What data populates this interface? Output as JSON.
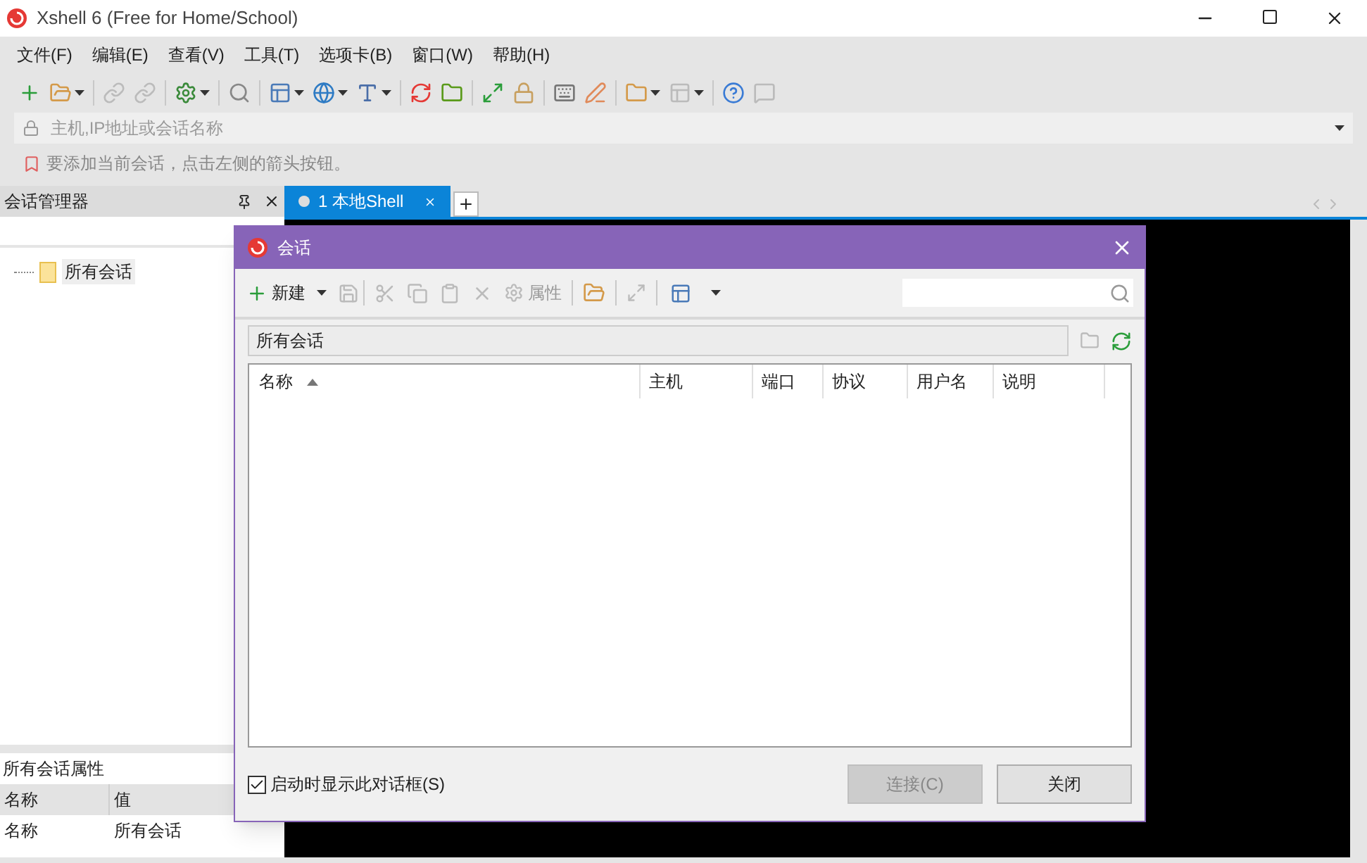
{
  "window": {
    "title": "Xshell 6 (Free for Home/School)"
  },
  "menu": [
    "文件(F)",
    "编辑(E)",
    "查看(V)",
    "工具(T)",
    "选项卡(B)",
    "窗口(W)",
    "帮助(H)"
  ],
  "address_bar": {
    "placeholder": "主机,IP地址或会话名称"
  },
  "hint_bar": {
    "text": "要添加当前会话，点击左侧的箭头按钮。"
  },
  "session_manager": {
    "title": "会话管理器",
    "tree": [
      {
        "label": "所有会话",
        "selected": true
      }
    ],
    "properties": {
      "title": "所有会话属性",
      "columns": [
        "名称",
        "值"
      ],
      "rows": [
        [
          "名称",
          "所有会话"
        ]
      ]
    }
  },
  "tabs": [
    {
      "label": "1 本地Shell",
      "selected": true
    }
  ],
  "dialog": {
    "title": "会话",
    "new_button": "新建",
    "properties_button": {
      "label": "属性",
      "disabled": true
    },
    "path": "所有会话",
    "columns": [
      {
        "label": "名称",
        "sorted": true
      },
      {
        "label": "主机",
        "sorted": false
      },
      {
        "label": "端口",
        "sorted": false
      },
      {
        "label": "协议",
        "sorted": false
      },
      {
        "label": "用户名",
        "sorted": false
      },
      {
        "label": "说明",
        "sorted": false
      }
    ],
    "startup_checkbox": {
      "label": "启动时显示此对话框(S)",
      "checked": true
    },
    "buttons": [
      {
        "label": "连接(C)",
        "disabled": true
      },
      {
        "label": "关闭",
        "disabled": false
      }
    ]
  }
}
